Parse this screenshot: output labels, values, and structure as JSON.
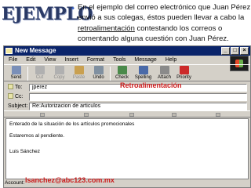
{
  "slide": {
    "title": "EJEMPLO",
    "bullet": "•",
    "text_before": "En el ejemplo del correo electrónico que Juan Pérez envió a sus colegas, éstos pueden llevar a cabo la ",
    "text_underline": "retroalimentación",
    "text_after": " contestando los correos o comentando alguna cuestión con Juan Pérez."
  },
  "window": {
    "title": "New Message",
    "menu": [
      "File",
      "Edit",
      "View",
      "Insert",
      "Format",
      "Tools",
      "Message",
      "Help"
    ],
    "toolbar": [
      {
        "label": "Send",
        "icon": "send-icon",
        "color": "#7a8fb8"
      },
      {
        "label": "Cut",
        "icon": "scissors-icon",
        "color": "#b0b0b0",
        "disabled": true
      },
      {
        "label": "Copy",
        "icon": "copy-icon",
        "color": "#b0b0b0",
        "disabled": true
      },
      {
        "label": "Paste",
        "icon": "clipboard-icon",
        "color": "#c9a050",
        "disabled": true
      },
      {
        "label": "Undo",
        "icon": "undo-icon",
        "color": "#8090a0"
      },
      {
        "label": "Check",
        "icon": "check-names-icon",
        "color": "#4a8a4a"
      },
      {
        "label": "Spelling",
        "icon": "spelling-icon",
        "color": "#4a6aa8"
      },
      {
        "label": "Attach",
        "icon": "paperclip-icon",
        "color": "#8a8a8a"
      },
      {
        "label": "Priority",
        "icon": "priority-icon",
        "color": "#cc2a2a"
      }
    ],
    "to_label": "To:",
    "to_value": "jperez",
    "cc_label": "Cc:",
    "cc_value": "",
    "subject_label": "Subject:",
    "subject_value": "Re:Autorizacion de articulos",
    "annotation_retro": "Retroalimentación",
    "body_lines": [
      "Enterado de la situación de los artículos promocionales",
      "Estaremos al pendiente.",
      "Luis Sánchez"
    ],
    "account_label": "Account:",
    "account_email": "lsanchez@abc123.com.mx"
  },
  "colors": {
    "accent": "#cc1a1a",
    "titlebar": "#0a246a",
    "slide_title": "#2a3a66"
  }
}
